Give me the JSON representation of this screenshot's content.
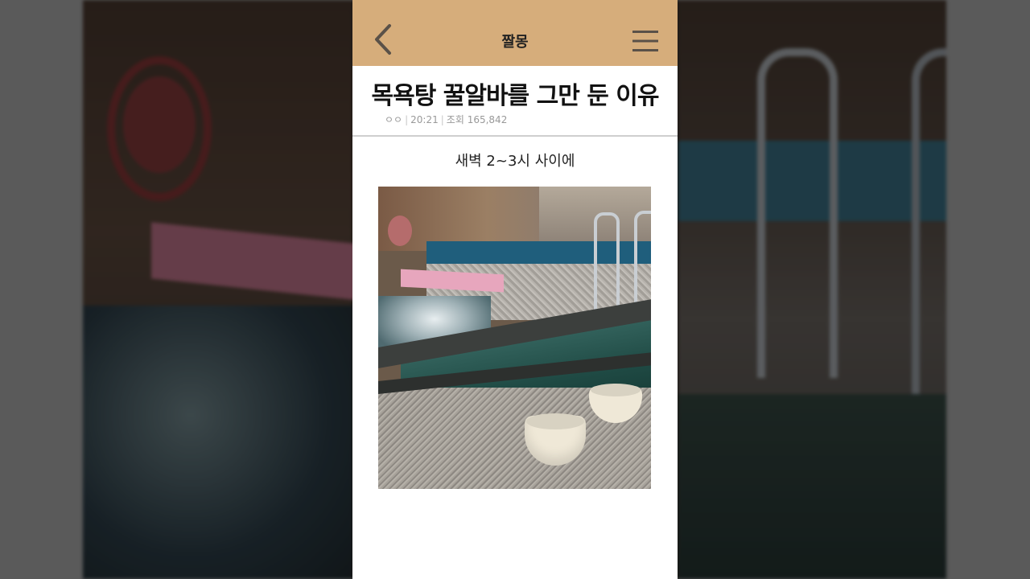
{
  "header": {
    "title": "짤몽"
  },
  "post": {
    "title": "목욕탕 꿀알바를 그만 둔 이유",
    "author": "ㅇㅇ",
    "time": "20:21",
    "views_label": "조회",
    "views": "165,842",
    "caption": "새벽 2~3시 사이에"
  },
  "colors": {
    "header_bg": "#d6ad7b",
    "page_bg": "#ffffff",
    "meta_text": "#999999"
  },
  "icons": {
    "back": "chevron-left-icon",
    "menu": "hamburger-menu-icon"
  }
}
